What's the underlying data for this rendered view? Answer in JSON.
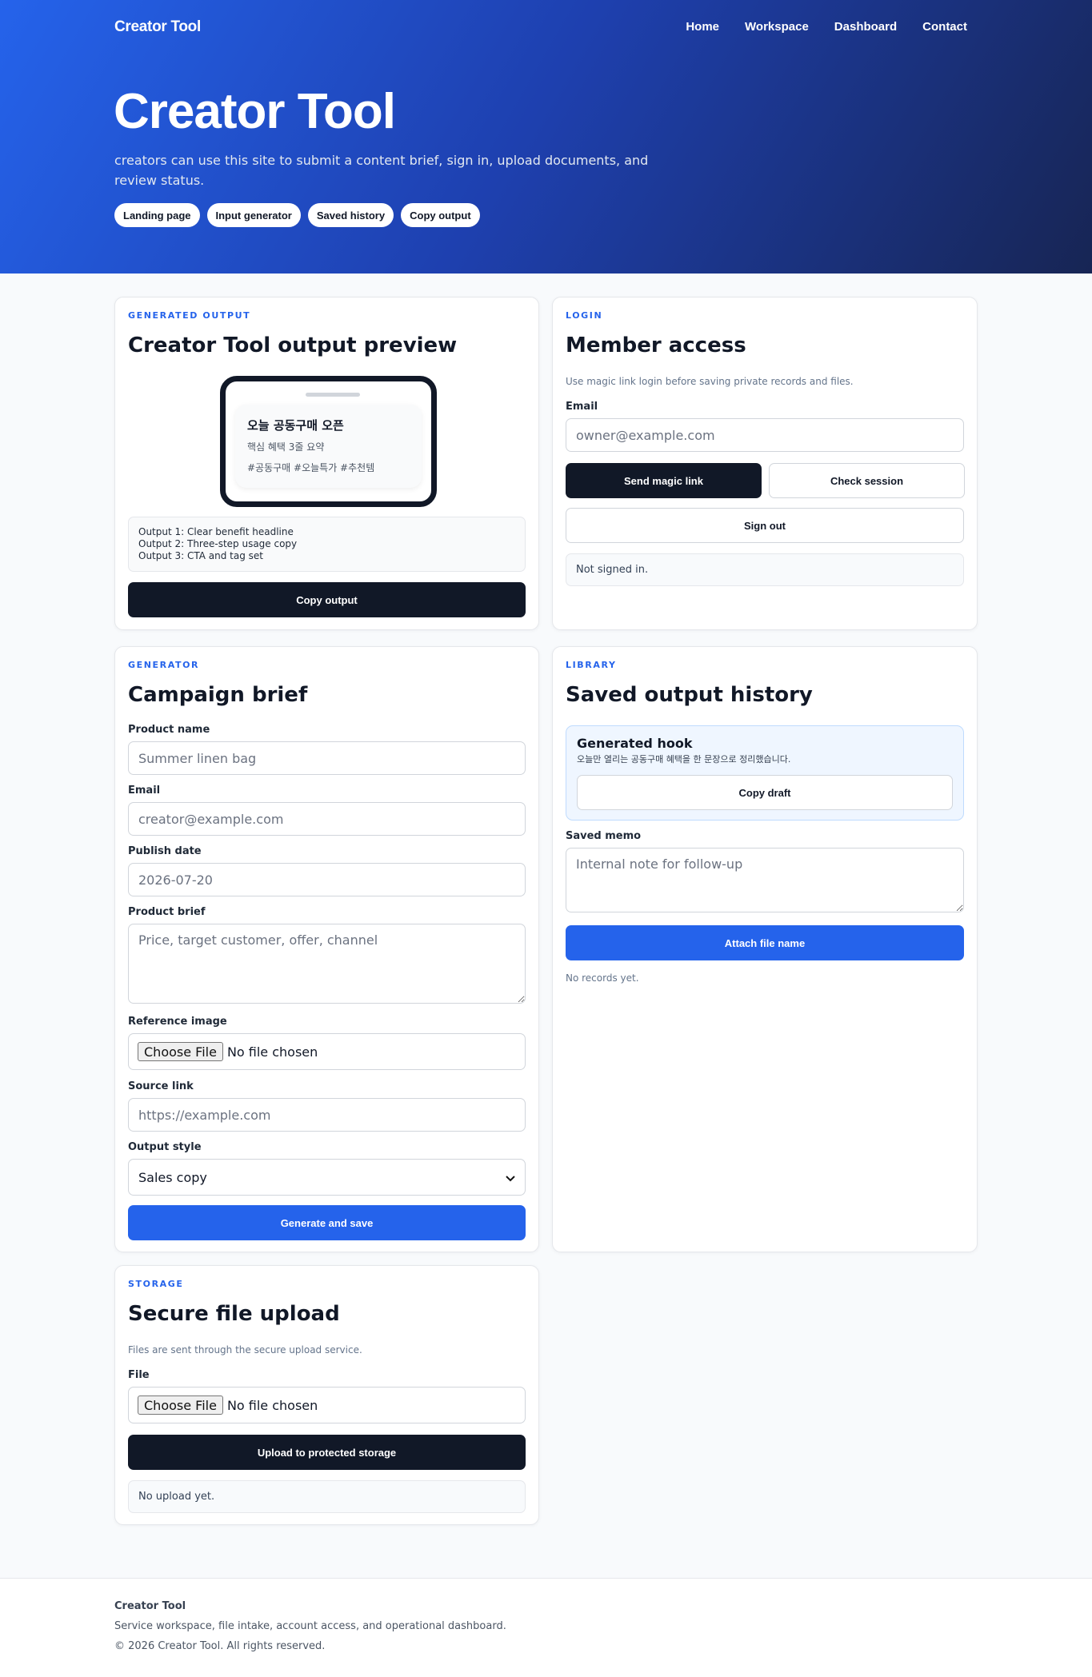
{
  "header": {
    "brand": "Creator Tool",
    "nav": [
      "Home",
      "Workspace",
      "Dashboard",
      "Contact"
    ],
    "title": "Creator Tool",
    "subtitle": "creators can use this site to submit a content brief, sign in, upload documents, and review status.",
    "chips": [
      "Landing page",
      "Input generator",
      "Saved history",
      "Copy output"
    ]
  },
  "preview": {
    "eyebrow": "GENERATED OUTPUT",
    "title": "Creator Tool output preview",
    "phone_headline": "오늘 공동구매 오픈",
    "phone_line2": "핵심 혜택 3줄 요약",
    "phone_line3": "#공동구매 #오늘특가 #추천템",
    "outputs": [
      "Output 1: Clear benefit headline",
      "Output 2: Three-step usage copy",
      "Output 3: CTA and tag set"
    ],
    "copy_button": "Copy output"
  },
  "login": {
    "eyebrow": "LOGIN",
    "title": "Member access",
    "description": "Use magic link login before saving private records and files.",
    "email_label": "Email",
    "email_placeholder": "owner@example.com",
    "send_button": "Send magic link",
    "check_button": "Check session",
    "signout_button": "Sign out",
    "status": "Not signed in."
  },
  "generator": {
    "eyebrow": "GENERATOR",
    "title": "Campaign brief",
    "product_label": "Product name",
    "product_placeholder": "Summer linen bag",
    "email_label": "Email",
    "email_placeholder": "creator@example.com",
    "date_label": "Publish date",
    "date_placeholder": "2026-07-20",
    "brief_label": "Product brief",
    "brief_placeholder": "Price, target customer, offer, channel",
    "image_label": "Reference image",
    "file_button": "Choose File",
    "file_status": "No file chosen",
    "link_label": "Source link",
    "link_placeholder": "https://example.com",
    "style_label": "Output style",
    "style_value": "Sales copy",
    "submit_button": "Generate and save"
  },
  "library": {
    "eyebrow": "LIBRARY",
    "title": "Saved output history",
    "hook_title": "Generated hook",
    "hook_text": "오늘만 열리는 공동구매 혜택을 한 문장으로 정리했습니다.",
    "copy_draft": "Copy draft",
    "memo_label": "Saved memo",
    "memo_placeholder": "Internal note for follow-up",
    "attach_button": "Attach file name",
    "empty": "No records yet."
  },
  "storage": {
    "eyebrow": "STORAGE",
    "title": "Secure file upload",
    "description": "Files are sent through the secure upload service.",
    "file_label": "File",
    "file_button": "Choose File",
    "file_status": "No file chosen",
    "upload_button": "Upload to protected storage",
    "status": "No upload yet."
  },
  "footer": {
    "brand": "Creator Tool",
    "description": "Service workspace, file intake, account access, and operational dashboard.",
    "copyright": "© 2026 Creator Tool. All rights reserved."
  }
}
